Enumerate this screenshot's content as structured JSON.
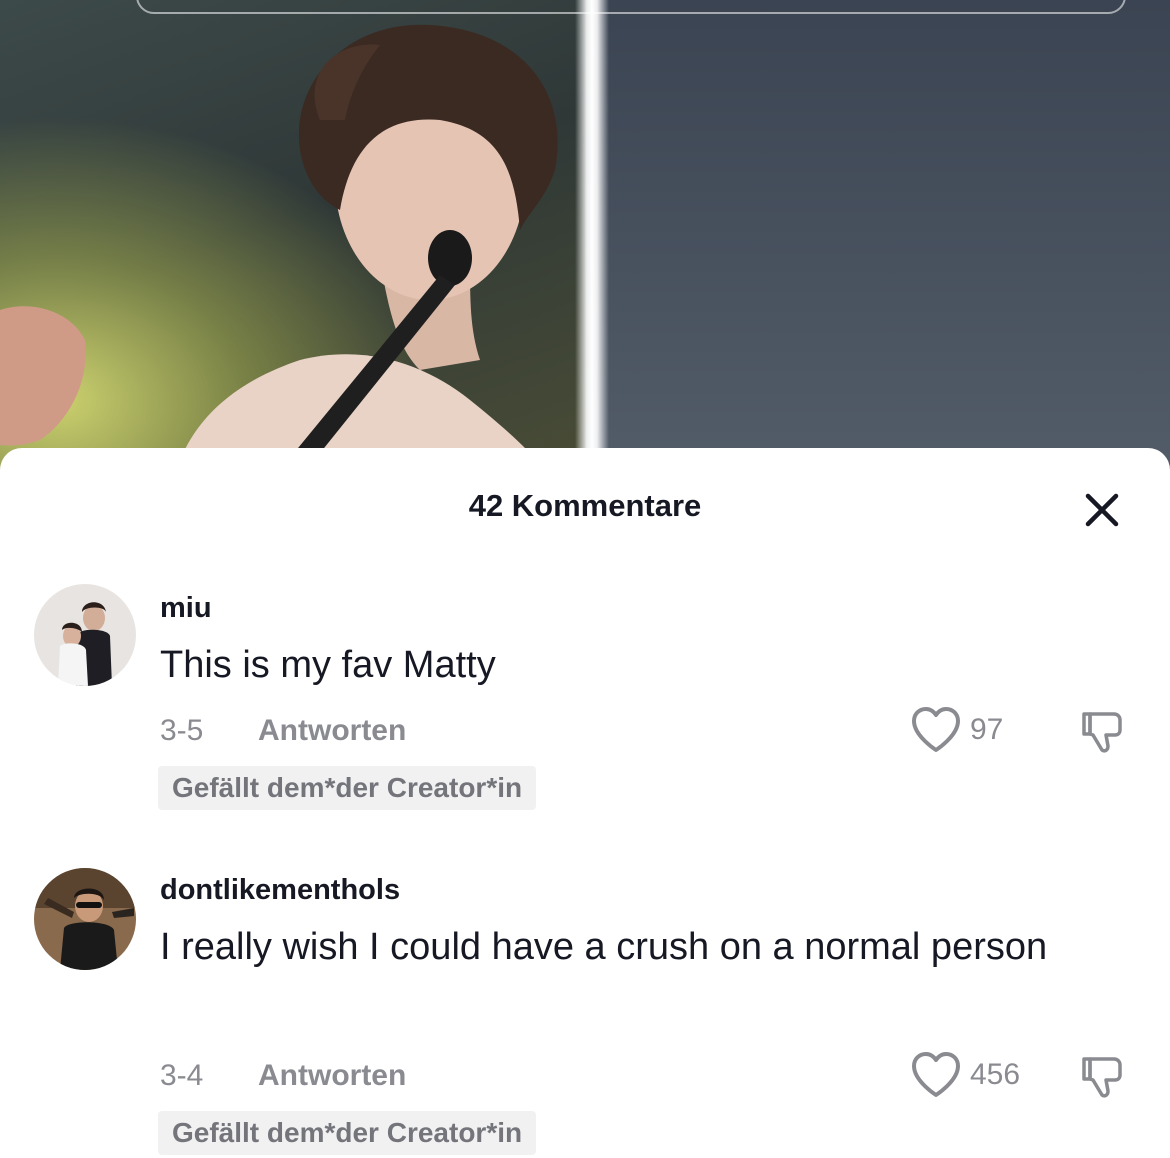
{
  "sheet": {
    "title": "42 Kommentare",
    "close_icon": "close-icon"
  },
  "comments": [
    {
      "username": "miu",
      "text": "This is my fav Matty",
      "date": "3-5",
      "reply_label": "Antworten",
      "likes": "97",
      "badge": "Gefällt dem*der Creator*in"
    },
    {
      "username": "dontlikementhols",
      "text": "I really wish I could have a crush on a normal person",
      "date": "3-4",
      "reply_label": "Antworten",
      "likes": "456",
      "badge": "Gefällt dem*der Creator*in"
    }
  ],
  "icons": {
    "like": "heart-outline-icon",
    "dislike": "thumbs-down-icon"
  },
  "colors": {
    "text_primary": "#161823",
    "text_secondary": "#8a8b91",
    "badge_bg": "#f1f1f2"
  }
}
